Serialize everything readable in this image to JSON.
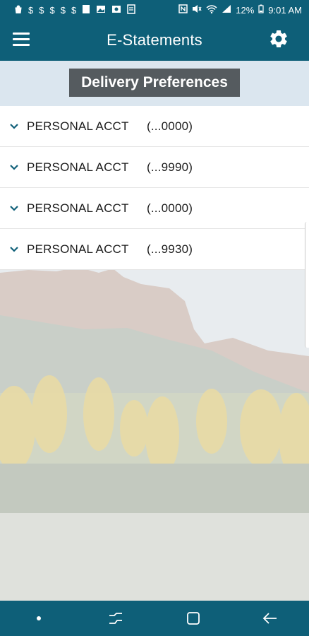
{
  "status_bar": {
    "icons": [
      "bag-icon",
      "dollar-icon",
      "dollar-icon",
      "dollar-icon",
      "dollar-icon",
      "dollar-icon",
      "wallet-icon",
      "image-icon",
      "photo-icon",
      "receipt-icon"
    ],
    "right_icons": [
      "nfc-icon",
      "mute-icon",
      "wifi-icon",
      "signal-icon"
    ],
    "battery": "12%",
    "time": "9:01 AM"
  },
  "app_bar": {
    "title": "E-Statements",
    "menu_icon": "hamburger-menu-icon",
    "settings_icon": "gear-icon",
    "color": "#0e5f78"
  },
  "preferences": {
    "button_label": "Delivery Preferences"
  },
  "accounts": [
    {
      "name": "PERSONAL ACCT",
      "number": "(...0000)"
    },
    {
      "name": "PERSONAL ACCT",
      "number": "(...9990)"
    },
    {
      "name": "PERSONAL ACCT",
      "number": "(...0000)"
    },
    {
      "name": "PERSONAL ACCT",
      "number": "(...9930)"
    }
  ],
  "nav_bar": {
    "items": [
      "dot-icon",
      "recent-apps-icon",
      "home-icon",
      "back-icon"
    ]
  }
}
